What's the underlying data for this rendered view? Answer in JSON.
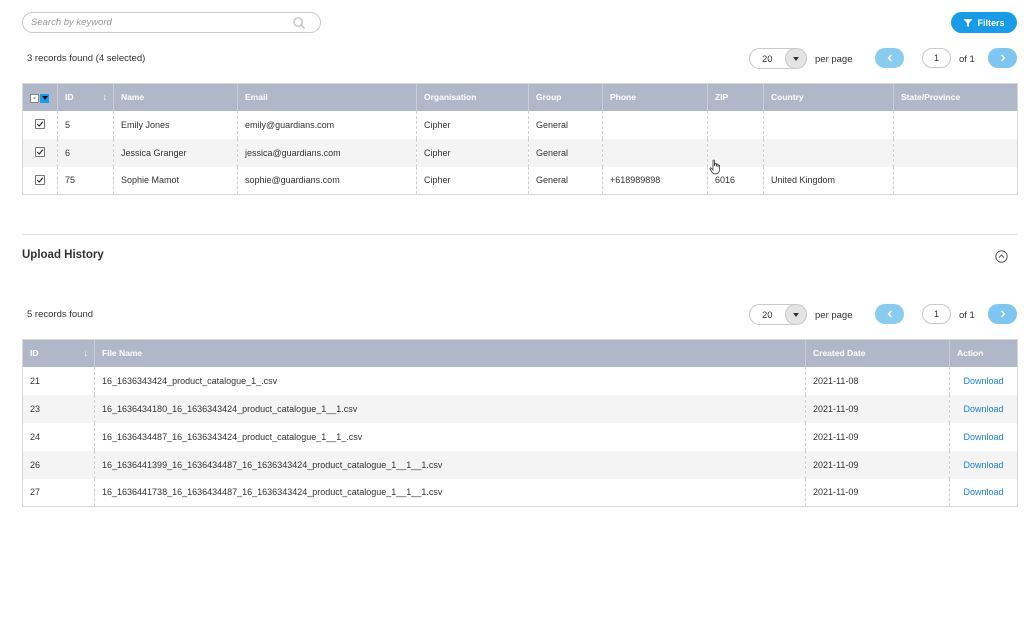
{
  "search": {
    "placeholder": "Search by keyword"
  },
  "filters_label": "Filters",
  "colors": {
    "accent": "#1a9be8",
    "header_bg": "#b0b7c9",
    "link": "#1a7fd0"
  },
  "records_table": {
    "summary": "3 records found (4 selected)",
    "pagination": {
      "per_page_value": "20",
      "per_page_label": "per page",
      "page": "1",
      "of_label": "of 1"
    },
    "columns": [
      "ID",
      "Name",
      "Email",
      "Organisation",
      "Group",
      "Phone",
      "ZIP",
      "Country",
      "State/Province"
    ],
    "sort_indicator": "↓",
    "rows": [
      {
        "checked": true,
        "id": "5",
        "name": "Emily Jones",
        "email": "emily@guardians.com",
        "organisation": "Cipher",
        "group": "General",
        "phone": "",
        "zip": "",
        "country": "",
        "state": ""
      },
      {
        "checked": true,
        "id": "6",
        "name": "Jessica Granger",
        "email": "jessica@guardians.com",
        "organisation": "Cipher",
        "group": "General",
        "phone": "",
        "zip": "",
        "country": "",
        "state": ""
      },
      {
        "checked": true,
        "id": "75",
        "name": "Sophie Mamot",
        "email": "sophie@guardians.com",
        "organisation": "Cipher",
        "group": "General",
        "phone": "+618989898",
        "zip": "6016",
        "country": "United Kingdom",
        "state": ""
      }
    ]
  },
  "upload_history": {
    "title": "Upload History",
    "summary": "5 records found",
    "pagination": {
      "per_page_value": "20",
      "per_page_label": "per page",
      "page": "1",
      "of_label": "of 1"
    },
    "columns": [
      "ID",
      "File Name",
      "Created Date",
      "Action"
    ],
    "sort_indicator": "↓",
    "rows": [
      {
        "id": "21",
        "file_name": "16_1636343424_product_catalogue_1_.csv",
        "created": "2021-11-08",
        "action": "Download"
      },
      {
        "id": "23",
        "file_name": "16_1636434180_16_1636343424_product_catalogue_1__1.csv",
        "created": "2021-11-09",
        "action": "Download"
      },
      {
        "id": "24",
        "file_name": "16_1636434487_16_1636343424_product_catalogue_1__1_.csv",
        "created": "2021-11-09",
        "action": "Download"
      },
      {
        "id": "26",
        "file_name": "16_1636441399_16_1636434487_16_1636343424_product_catalogue_1__1__1.csv",
        "created": "2021-11-09",
        "action": "Download"
      },
      {
        "id": "27",
        "file_name": "16_1636441738_16_1636434487_16_1636343424_product_catalogue_1__1__1.csv",
        "created": "2021-11-09",
        "action": "Download"
      }
    ]
  }
}
